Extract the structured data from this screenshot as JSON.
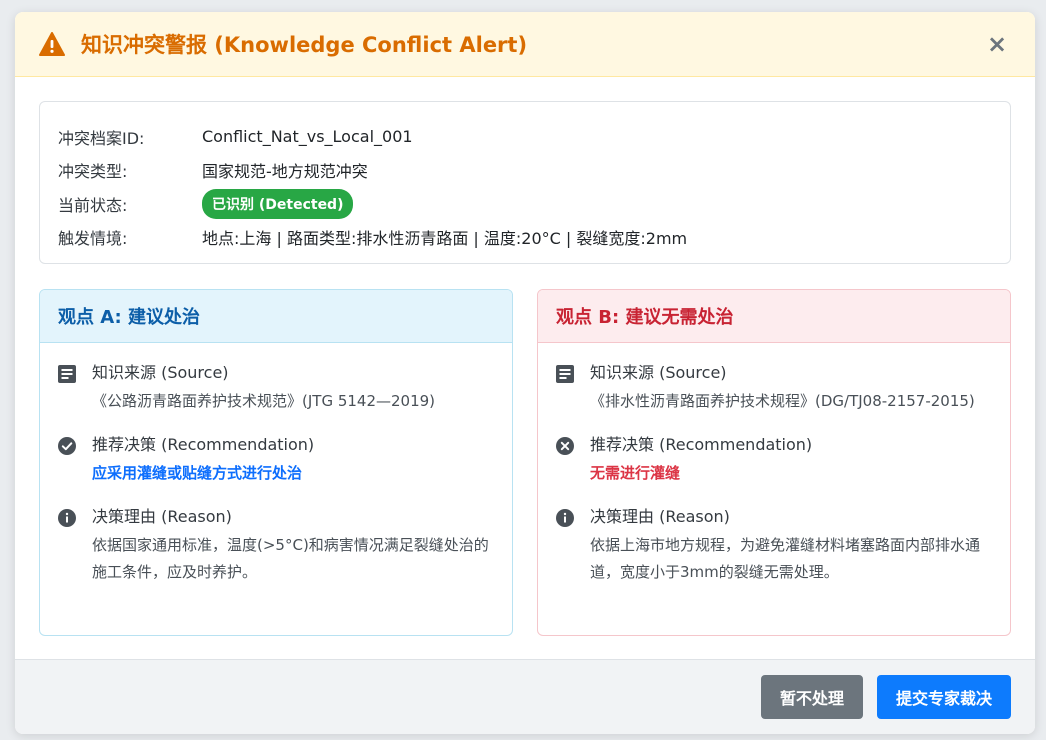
{
  "header": {
    "title": "知识冲突警报 (Knowledge Conflict Alert)",
    "close_label": "×",
    "accent_color": "#d96c00"
  },
  "info": {
    "rows": [
      {
        "label": "冲突档案ID:",
        "value": "Conflict_Nat_vs_Local_001"
      },
      {
        "label": "冲突类型:",
        "value": "国家规范-地方规范冲突"
      },
      {
        "label": "当前状态:",
        "value": "已识别 (Detected)"
      },
      {
        "label": "触发情境:",
        "value": "地点:上海 | 路面类型:排水性沥青路面 | 温度:20°C | 裂缝宽度:2mm"
      }
    ]
  },
  "view_a": {
    "title": "观点 A: 建议处治",
    "source_title": "知识来源 (Source)",
    "source_text": "《公路沥青路面养护技术规范》(JTG 5142—2019)",
    "rec_title": "推荐决策 (Recommendation)",
    "rec_text": "应采用灌缝或贴缝方式进行处治",
    "reason_title": "决策理由 (Reason)",
    "reason_text": "依据国家通用标准，温度(>5°C)和病害情况满足裂缝处治的施工条件，应及时养护。",
    "color": "#0c5ea8"
  },
  "view_b": {
    "title": "观点 B: 建议无需处治",
    "source_title": "知识来源 (Source)",
    "source_text": "《排水性沥青路面养护技术规程》(DG/TJ08-2157-2015)",
    "rec_title": "推荐决策 (Recommendation)",
    "rec_text": "无需进行灌缝",
    "reason_title": "决策理由 (Reason)",
    "reason_text": "依据上海市地方规程，为避免灌缝材料堵塞路面内部排水通道，宽度小于3mm的裂缝无需处理。",
    "color": "#c82333"
  },
  "footer": {
    "defer_label": "暂不处理",
    "submit_label": "提交专家裁决"
  },
  "icons": {
    "header": "warning-triangle-icon",
    "source": "document-icon",
    "rec_a": "check-circle-icon",
    "rec_b": "x-circle-icon",
    "reason": "info-icon"
  }
}
